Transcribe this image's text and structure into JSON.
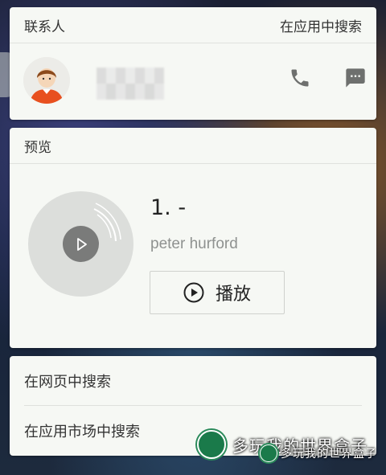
{
  "contacts": {
    "header": "联系人",
    "search_in_app": "在应用中搜索",
    "call_icon": "phone-icon",
    "message_icon": "message-icon"
  },
  "preview": {
    "header": "预览",
    "track_title": "1. -",
    "artist": "peter hurford",
    "play_label": "播放"
  },
  "searches": {
    "web": "在网页中搜索",
    "market": "在应用市场中搜索"
  },
  "watermark": {
    "text": "多玩我的世界盒子"
  },
  "colors": {
    "card_bg": "#f6f8f4",
    "divider": "#e0e2de",
    "icon_gray": "#6e706e",
    "avatar_shirt": "#e8501f"
  }
}
